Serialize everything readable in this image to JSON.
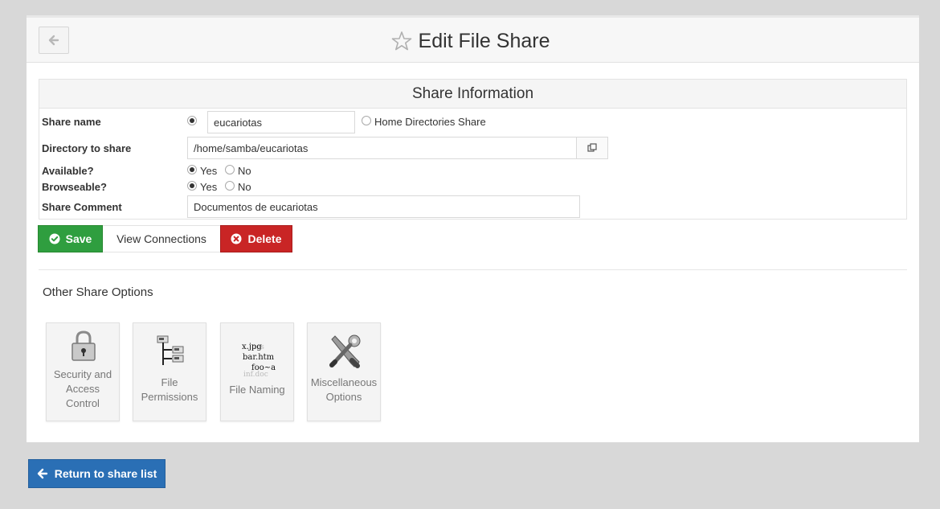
{
  "header": {
    "title": "Edit File Share",
    "back_icon": "arrow-left-icon",
    "favorite_icon": "star-icon"
  },
  "share_info": {
    "heading": "Share Information",
    "share_name_label": "Share name",
    "share_name_value": "eucariotas",
    "home_dirs_label": "Home Directories Share",
    "directory_label": "Directory to share",
    "directory_value": "/home/samba/eucariotas",
    "available_label": "Available?",
    "browseable_label": "Browseable?",
    "yes_label": "Yes",
    "no_label": "No",
    "available_selected": "Yes",
    "browseable_selected": "Yes",
    "comment_label": "Share Comment",
    "comment_value": "Documentos de eucariotas"
  },
  "actions": {
    "save": "Save",
    "view_connections": "View Connections",
    "delete": "Delete"
  },
  "other_options": {
    "title": "Other Share Options",
    "tiles": [
      {
        "label_lines": [
          "Security and",
          "Access",
          "Control"
        ],
        "icon": "padlock-icon"
      },
      {
        "label_lines": [
          "File",
          "Permissions"
        ],
        "icon": "file-tree-icon"
      },
      {
        "label_lines": [
          "File Naming"
        ],
        "icon": "file-naming-icon",
        "icon_text": [
          "x.jpg",
          "bar.htm",
          "foo~a",
          "inf.doc"
        ]
      },
      {
        "label_lines": [
          "Miscellaneous",
          "Options"
        ],
        "icon": "tools-icon"
      }
    ]
  },
  "footer": {
    "return_label": "Return to share list"
  },
  "colors": {
    "save": "#2f9e3f",
    "delete": "#c92525",
    "return": "#2a6fb5",
    "page_bg": "#d8d8d8"
  }
}
